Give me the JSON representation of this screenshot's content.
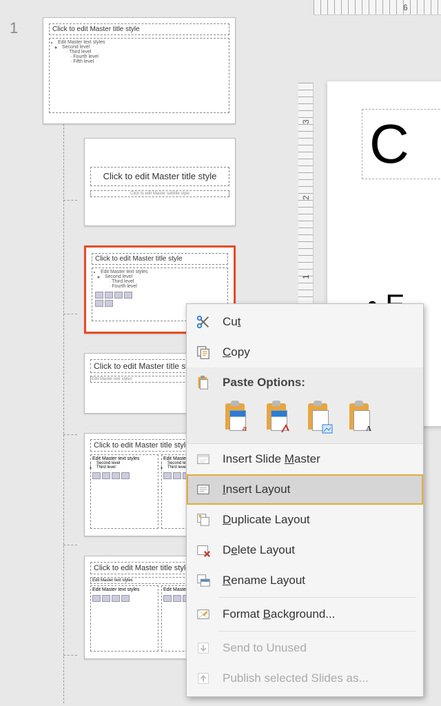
{
  "panel": {
    "slide_number": "1",
    "master": {
      "title": "Click to edit Master title style",
      "bullets": [
        "Edit Master text styles",
        "Second level",
        "Third level",
        "Fourth level",
        "Fifth level"
      ]
    },
    "layouts": [
      {
        "title": "Click to edit Master title style",
        "subtitle": "Click to edit Master subtitle style",
        "kind": "title"
      },
      {
        "title": "Click to edit Master title style",
        "bullets": [
          "Edit Master text styles",
          "Second level",
          "Third level",
          "Fourth level"
        ],
        "kind": "content",
        "selected": true
      },
      {
        "title": "Click to edit Master title style",
        "subtitle": "Edit Master text styles",
        "kind": "section"
      },
      {
        "title": "Click to edit Master title style",
        "kind": "two_content",
        "left_head": "Edit Master text styles",
        "right_head": "Edit Master text styles"
      },
      {
        "title": "Click to edit Master title style",
        "kind": "comparison",
        "left_head": "Edit Master text styles",
        "right_head": "Edit Master text styles"
      }
    ]
  },
  "canvas": {
    "title_fragment": "C",
    "bullet_fragment": "• E"
  },
  "ruler": {
    "h_label": "6",
    "v_labels": [
      "3",
      "2",
      "1"
    ]
  },
  "context_menu": {
    "cut": "Cut",
    "copy": "Copy",
    "paste_header": "Paste Options:",
    "paste_options": [
      {
        "id": "use-destination-theme",
        "badge": "a"
      },
      {
        "id": "keep-source-formatting",
        "badge": ""
      },
      {
        "id": "picture",
        "badge": ""
      },
      {
        "id": "keep-text-only",
        "badge": "A"
      }
    ],
    "insert_slide_master": "Insert Slide Master",
    "insert_layout": "Insert Layout",
    "duplicate_layout": "Duplicate Layout",
    "delete_layout": "Delete Layout",
    "rename_layout": "Rename Layout",
    "format_background": "Format Background...",
    "send_to_unused": "Send to Unused",
    "publish_selected": "Publish selected Slides as..."
  }
}
